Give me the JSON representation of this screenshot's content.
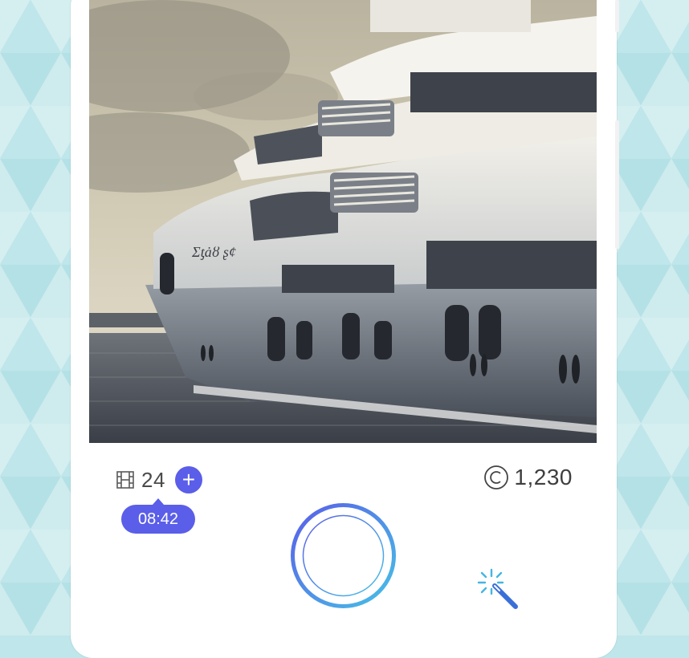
{
  "screen": {
    "film_count": "24",
    "add_label": "+",
    "timer": "08:42",
    "coins": "1,230"
  },
  "colors": {
    "accent": "#5a5ee8",
    "background": "#bfe6ea",
    "shutter_ring_start": "#5a5ee8",
    "shutter_ring_end": "#47c1e6"
  },
  "icons": {
    "film": "film-icon",
    "coin": "copyright-coin-icon",
    "magic": "magic-wand-icon"
  }
}
